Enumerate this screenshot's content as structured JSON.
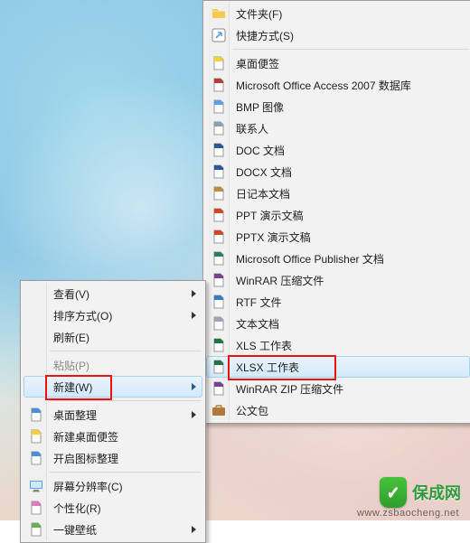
{
  "mainMenu": {
    "items": [
      {
        "id": "view",
        "label": "查看(V)",
        "submenu": true
      },
      {
        "id": "sort",
        "label": "排序方式(O)",
        "submenu": true
      },
      {
        "id": "refresh",
        "label": "刷新(E)"
      },
      {
        "sep": true
      },
      {
        "id": "paste",
        "label": "粘贴(P)",
        "disabled": true
      },
      {
        "id": "new",
        "label": "新建(W)",
        "submenu": true,
        "highlight": true
      },
      {
        "sep": true
      },
      {
        "id": "desk-arrange",
        "label": "桌面整理",
        "icon": "grid",
        "submenu": true
      },
      {
        "id": "new-note",
        "label": "新建桌面便签",
        "icon": "note-yellow"
      },
      {
        "id": "start-icon-mgr",
        "label": "开启图标整理",
        "icon": "tiles"
      },
      {
        "sep": true
      },
      {
        "id": "resolution",
        "label": "屏幕分辨率(C)",
        "icon": "monitor"
      },
      {
        "id": "personalize",
        "label": "个性化(R)",
        "icon": "personalize"
      },
      {
        "id": "wallpaper",
        "label": "一键壁纸",
        "icon": "wallpaper",
        "submenu": true
      }
    ]
  },
  "subMenu": {
    "items": [
      {
        "id": "folder",
        "label": "文件夹(F)",
        "icon": "folder"
      },
      {
        "id": "shortcut",
        "label": "快捷方式(S)",
        "icon": "shortcut"
      },
      {
        "sep": true
      },
      {
        "id": "sticky",
        "label": "桌面便签",
        "icon": "note-yellow"
      },
      {
        "id": "access",
        "label": "Microsoft Office Access 2007 数据库",
        "icon": "access"
      },
      {
        "id": "bmp",
        "label": "BMP 图像",
        "icon": "bmp"
      },
      {
        "id": "contact",
        "label": "联系人",
        "icon": "contact"
      },
      {
        "id": "doc",
        "label": "DOC 文档",
        "icon": "word"
      },
      {
        "id": "docx",
        "label": "DOCX 文档",
        "icon": "word"
      },
      {
        "id": "journal",
        "label": "日记本文档",
        "icon": "journal"
      },
      {
        "id": "ppt",
        "label": "PPT 演示文稿",
        "icon": "ppt"
      },
      {
        "id": "pptx",
        "label": "PPTX 演示文稿",
        "icon": "ppt"
      },
      {
        "id": "pub",
        "label": "Microsoft Office Publisher 文档",
        "icon": "publisher"
      },
      {
        "id": "rar",
        "label": "WinRAR 压缩文件",
        "icon": "rar"
      },
      {
        "id": "rtf",
        "label": "RTF 文件",
        "icon": "rtf"
      },
      {
        "id": "txt",
        "label": "文本文档",
        "icon": "txt"
      },
      {
        "id": "xls",
        "label": "XLS 工作表",
        "icon": "excel"
      },
      {
        "id": "xlsx",
        "label": "XLSX 工作表",
        "icon": "excel",
        "highlight": true
      },
      {
        "id": "zip",
        "label": "WinRAR ZIP 压缩文件",
        "icon": "rar"
      },
      {
        "id": "briefcase",
        "label": "公文包",
        "icon": "briefcase"
      }
    ]
  },
  "logo": {
    "brand": "保成网"
  },
  "watermark": "www.zsbaocheng.net",
  "annotations": [
    {
      "target": "new",
      "menu": "main"
    },
    {
      "target": "xlsx",
      "menu": "sub"
    }
  ]
}
